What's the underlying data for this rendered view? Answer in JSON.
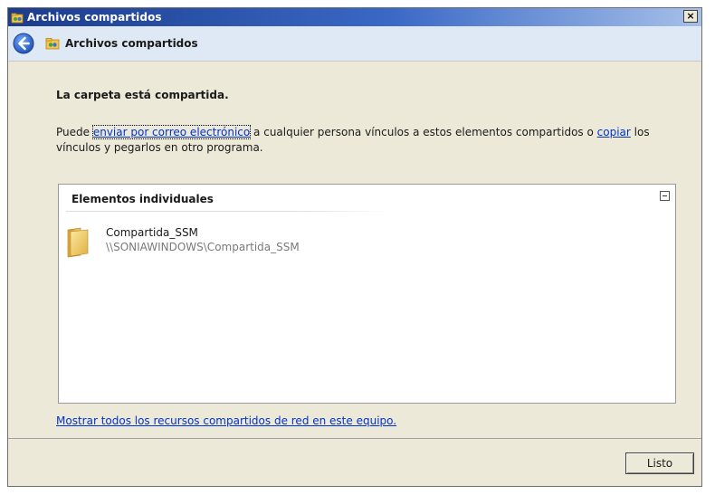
{
  "window": {
    "title": "Archivos compartidos",
    "close_glyph": "×"
  },
  "nav": {
    "title": "Archivos compartidos",
    "back_icon": "back-arrow-icon",
    "wizard_icon": "shared-files-icon"
  },
  "content": {
    "heading": "La carpeta está compartida.",
    "paragraph": {
      "prefix": "Puede ",
      "email_link": "enviar por correo electrónico",
      "middle": " a cualquier persona vínculos a estos elementos compartidos o ",
      "copy_link": "copiar",
      "suffix": " los vínculos y pegarlos en otro programa."
    },
    "panel": {
      "header": "Elementos individuales",
      "items": [
        {
          "name": "Compartida_SSM",
          "path": "\\\\SONIAWINDOWS\\Compartida_SSM",
          "icon": "folder-icon"
        }
      ]
    },
    "show_all_link": "Mostrar todos los recursos compartidos de red en este equipo."
  },
  "footer": {
    "done_label": "Listo"
  },
  "colors": {
    "link": "#0033cc",
    "titlebar_start": "#1c3c8c",
    "dialog_bg": "#ece9d8"
  }
}
